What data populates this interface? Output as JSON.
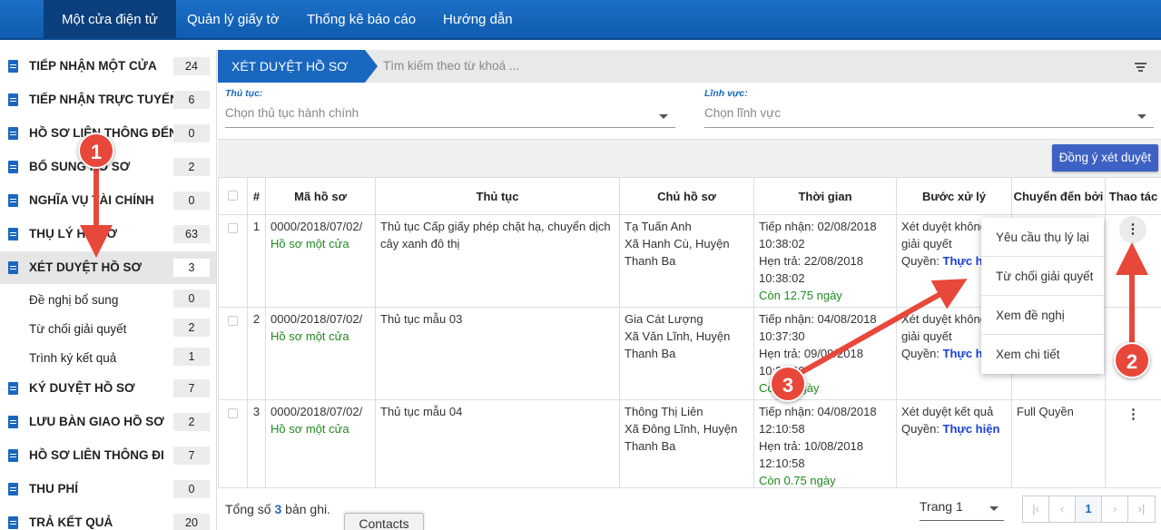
{
  "nav": {
    "tabs": [
      "Một cửa điện tử",
      "Quản lý giấy tờ",
      "Thống kê báo cáo",
      "Hướng dẫn"
    ]
  },
  "sidebar": {
    "items": [
      {
        "label": "TIẾP NHẬN MỘT CỬA",
        "count": "24"
      },
      {
        "label": "TIẾP NHẬN TRỰC TUYẾN",
        "count": "6"
      },
      {
        "label": "HỒ SƠ LIÊN THÔNG ĐẾN",
        "count": "0"
      },
      {
        "label": "BỔ SUNG HỒ SƠ",
        "count": "2"
      },
      {
        "label": "NGHĨA VỤ TÀI CHÍNH",
        "count": "0"
      },
      {
        "label": "THỤ LÝ HỒ SƠ",
        "count": "63"
      },
      {
        "label": "XÉT DUYỆT HỒ SƠ",
        "count": "3"
      },
      {
        "label": "Đề nghị bổ sung",
        "count": "0"
      },
      {
        "label": "Từ chối giải quyết",
        "count": "2"
      },
      {
        "label": "Trình ký kết quả",
        "count": "1"
      },
      {
        "label": "KÝ DUYỆT HỒ SƠ",
        "count": "7"
      },
      {
        "label": "LƯU BÀN GIAO HỒ SƠ",
        "count": "2"
      },
      {
        "label": "HỒ SƠ LIÊN THÔNG ĐI",
        "count": "7"
      },
      {
        "label": "THU PHÍ",
        "count": "0"
      },
      {
        "label": "TRẢ KẾT QUẢ",
        "count": "20"
      }
    ]
  },
  "header": {
    "breadcrumb": "XÉT DUYỆT HỒ SƠ",
    "search_placeholder": "Tìm kiếm theo từ khoá ..."
  },
  "filters": {
    "procedure_label": "Thủ tục:",
    "procedure_placeholder": "Chọn thủ tục hành chính",
    "field_label": "Lĩnh vực:",
    "field_placeholder": "Chọn lĩnh vực"
  },
  "toolbar": {
    "approve_label": "Đồng ý xét duyệt"
  },
  "table": {
    "headers": [
      "#",
      "Mã hồ sơ",
      "Thủ tục",
      "Chủ hồ sơ",
      "Thời gian",
      "Bước xử lý",
      "Chuyển đến bởi",
      "Thao tác"
    ],
    "rows": [
      {
        "num": "1",
        "code": "0000/2018/07/02/",
        "source": "Hồ sơ một cửa",
        "procedure": "Thủ tục Cấp giấy phép chặt hạ, chuyển dịch cây xanh đô thị",
        "owner": "Tạ Tuấn Anh",
        "address": "Xã Hanh Cù, Huyện Thanh Ba",
        "received": "Tiếp nhận: 02/08/2018 10:38:02",
        "due": "Hẹn trả: 22/08/2018 10:38:02",
        "remaining": "Còn 12.75 ngày",
        "step": "Xét duyệt không giải quyết",
        "perm_label": "Quyền:",
        "perm": "Thực hiện",
        "from": ""
      },
      {
        "num": "2",
        "code": "0000/2018/07/02/",
        "source": "Hồ sơ một cửa",
        "procedure": "Thủ tục mẫu 03",
        "owner": "Gia Cát Lượng",
        "address": "Xã Văn Lĩnh, Huyện Thanh Ba",
        "received": "Tiếp nhận: 04/08/2018 10:37:30",
        "due": "Hẹn trả: 09/09/2018 10:37:30",
        "remaining": "Còn 5 ngày",
        "step": "Xét duyệt không giải quyết",
        "perm_label": "Quyền:",
        "perm": "Thực hiện",
        "from": ""
      },
      {
        "num": "3",
        "code": "0000/2018/07/02/",
        "source": "Hồ sơ một cửa",
        "procedure": "Thủ tục mẫu 04",
        "owner": "Thông Thị Liên",
        "address": "Xã Đông Lĩnh, Huyện Thanh Ba",
        "received": "Tiếp nhận: 04/08/2018 12:10:58",
        "due": "Hẹn trả: 10/08/2018 12:10:58",
        "remaining": "Còn 0.75 ngày",
        "step": "Xét duyệt kết quả",
        "perm_label": "Quyền:",
        "perm": "Thực hiện",
        "from": "Full Quyền"
      }
    ]
  },
  "menu": {
    "items": [
      "Yêu cầu thụ lý lại",
      "Từ chối giải quyết",
      "Xem đề nghị",
      "Xem chi tiết"
    ]
  },
  "footer": {
    "total_prefix": "Tổng số",
    "total": "3",
    "total_suffix": "bản ghi.",
    "page_select": "Trang 1",
    "current_page": "1",
    "contacts": "Contacts"
  },
  "markers": [
    "1",
    "2",
    "3"
  ],
  "colors": {
    "primary": "#1a67bf",
    "green": "#1e8b1e",
    "marker": "#e8483a"
  }
}
